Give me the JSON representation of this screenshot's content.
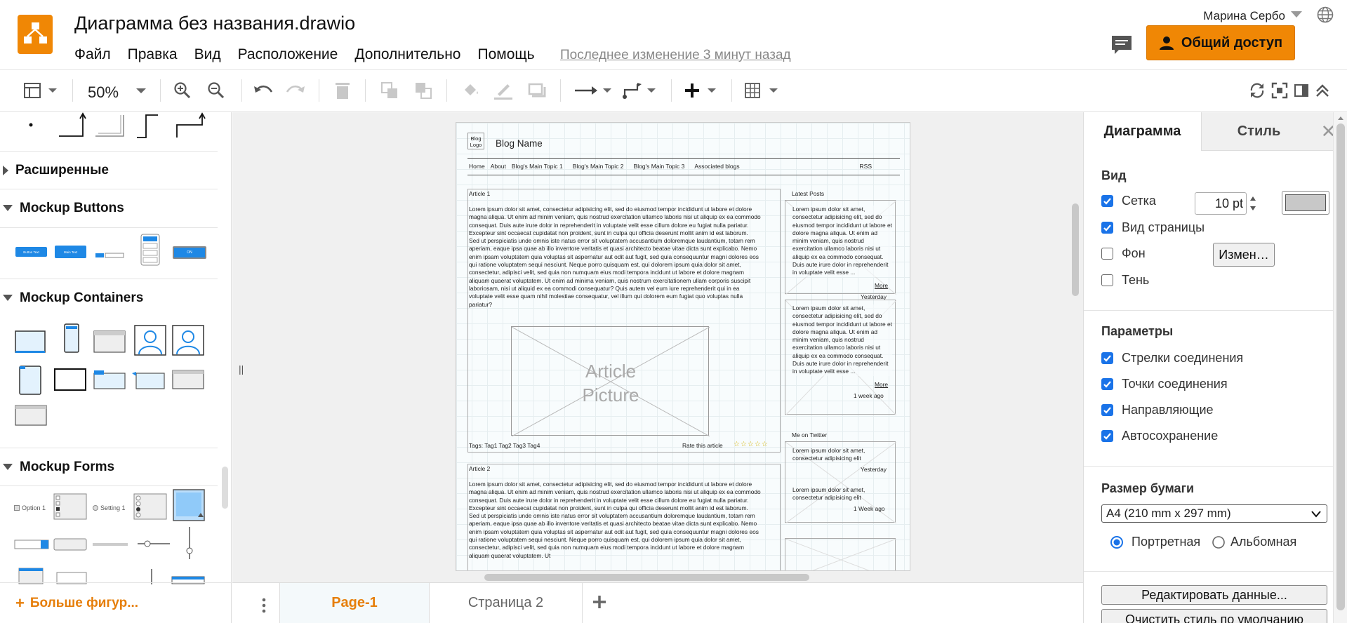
{
  "app": {
    "title": "Диаграмма без названия.drawio",
    "user": "Марина Сербо",
    "share_label": "Общий доступ",
    "last_change": "Последнее изменение 3 минут назад",
    "brand_color": "#f08705"
  },
  "menu": [
    "Файл",
    "Правка",
    "Вид",
    "Расположение",
    "Дополнительно",
    "Помощь"
  ],
  "toolbar": {
    "zoom": "50%",
    "icons": [
      "page-view-icon",
      "zoom-in-icon",
      "zoom-out-icon",
      "undo-icon",
      "redo-icon",
      "delete-icon",
      "to-front-icon",
      "to-back-icon",
      "fill-color-icon",
      "line-color-icon",
      "shadow-icon",
      "connection-icon",
      "waypoints-icon",
      "insert-icon",
      "table-icon",
      "refresh-icon",
      "fullscreen-icon",
      "format-panel-icon",
      "collapse-icon"
    ]
  },
  "sidebar": {
    "sections": [
      {
        "label": "Расширенные",
        "expanded": false
      },
      {
        "label": "Mockup Buttons",
        "expanded": true
      },
      {
        "label": "Mockup Containers",
        "expanded": true
      },
      {
        "label": "Mockup Forms",
        "expanded": true
      }
    ],
    "more_shapes": "Больше фигур...",
    "button_shapes": [
      "Button Text",
      "Main Text",
      "ON"
    ],
    "form_shapes": [
      "Option 1",
      "Setting 1"
    ]
  },
  "diagram": {
    "blog_logo": "Blog Logo",
    "blog_name": "Blog Name",
    "nav": [
      "Home",
      "About",
      "Blog's Main Topic 1",
      "Blog's Main Topic 2",
      "Blog's Main Topic 3",
      "Associated blogs",
      "RSS"
    ],
    "article1_title": "Article 1",
    "article2_title": "Article 2",
    "article_text": "Lorem ipsum dolor sit amet, consectetur adipisicing elit, sed do eiusmod tempor incididunt ut labore et dolore magna aliqua. Ut enim ad minim veniam, quis nostrud exercitation ullamco laboris nisi ut aliquip ex ea commodo consequat. Duis aute irure dolor in reprehenderit in voluptate velit esse cillum dolore eu fugiat nulla pariatur. Excepteur sint occaecat cupidatat non proident, sunt in culpa qui officia deserunt mollit anim id est laborum.\nSed ut perspiciatis unde omnis iste natus error sit voluptatem accusantium doloremque laudantium, totam rem aperiam, eaque ipsa quae ab illo inventore veritatis et quasi architecto beatae vitae dicta sunt explicabo. Nemo enim ipsam voluptatem quia voluptas sit aspernatur aut odit aut fugit, sed quia consequuntur magni dolores eos qui ratione voluptatem sequi nesciunt. Neque porro quisquam est, qui dolorem ipsum quia dolor sit amet, consectetur, adipisci velit, sed quia non numquam eius modi tempora incidunt ut labore et dolore magnam aliquam quaerat voluptatem. Ut enim ad minima veniam, quis nostrum exercitationem ullam corporis suscipit laboriosam, nisi ut aliquid ex ea commodi consequatur? Quis autem vel eum iure reprehenderit qui in ea voluptate velit esse quam nihil molestiae consequatur, vel illum qui dolorem eum fugiat quo voluptas nulla pariatur?",
    "article_text2": "Lorem ipsum dolor sit amet, consectetur adipisicing elit, sed do eiusmod tempor incididunt ut labore et dolore magna aliqua. Ut enim ad minim veniam, quis nostrud exercitation ullamco laboris nisi ut aliquip ex ea commodo consequat. Duis aute irure dolor in reprehenderit in voluptate velit esse cillum dolore eu fugiat nulla pariatur. Excepteur sint occaecat cupidatat non proident, sunt in culpa qui officia deserunt mollit anim id est laborum.\nSed ut perspiciatis unde omnis iste natus error sit voluptatem accusantium doloremque laudantium, totam rem aperiam, eaque ipsa quae ab illo inventore veritatis et quasi architecto beatae vitae dicta sunt explicabo. Nemo enim ipsam voluptatem quia voluptas sit aspernatur aut odit aut fugit, sed quia consequuntur magni dolores eos qui ratione voluptatem sequi nesciunt. Neque porro quisquam est, qui dolorem ipsum quia dolor sit amet, consectetur, adipisci velit, sed quia non numquam eius modi tempora incidunt ut labore et dolore magnam aliquam quaerat voluptatem. Ut",
    "article_picture": "Article\nPicture",
    "tags": "Tags: Tag1 Tag2 Tag3 Tag4",
    "rate": "Rate this article",
    "latest_posts": "Latest Posts",
    "post_text": "Lorem ipsum dolor sit amet, consectetur adipisicing elit, sed do eiusmod tempor incididunt ut labore et dolore magna aliqua. Ut enim ad minim veniam, quis nostrud exercitation ullamco laboris nisi ut aliquip ex ea commodo consequat. Duis aute irure dolor in reprehenderit in voluptate velit esse ...",
    "more": "More",
    "yesterday": "Yesterday",
    "week_ago": "1 week ago",
    "twitter": "Me on Twitter",
    "tweet_text": "Lorem ipsum dolor sit amet, consectetur adipisicing elit",
    "tweet_yesterday": "Yesterday",
    "tweet_week": "1 Week ago"
  },
  "pages": {
    "tabs": [
      "Page-1",
      "Страница 2"
    ],
    "active": "Page-1"
  },
  "format_panel": {
    "tabs": [
      "Диаграмма",
      "Стиль"
    ],
    "view_header": "Вид",
    "grid_label": "Сетка",
    "grid_size": "10 pt",
    "grid_color": "#c8c8c8",
    "page_view_label": "Вид страницы",
    "background_label": "Фон",
    "change_button": "Измен…",
    "shadow_label": "Тень",
    "options_header": "Параметры",
    "options": [
      {
        "label": "Стрелки соединения",
        "checked": true
      },
      {
        "label": "Точки соединения",
        "checked": true
      },
      {
        "label": "Направляющие",
        "checked": true
      },
      {
        "label": "Автосохранение",
        "checked": true
      }
    ],
    "paper_header": "Размер бумаги",
    "paper_size": "A4 (210 mm x 297 mm)",
    "portrait": "Портретная",
    "landscape": "Альбомная",
    "edit_data": "Редактировать данные...",
    "clear_style": "Очистить стиль по умолчанию",
    "checkbox_color": "#1a73e8"
  }
}
